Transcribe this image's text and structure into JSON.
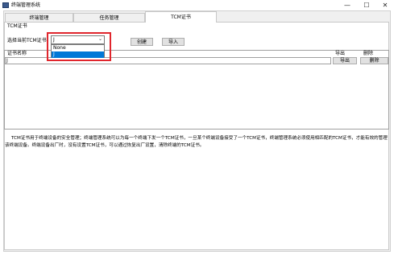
{
  "window": {
    "title": "终端管理系统",
    "minimize_glyph": "—",
    "maximize_glyph": "☐",
    "close_glyph": "✕"
  },
  "tabs": [
    {
      "label": "终端管理"
    },
    {
      "label": "任务管理"
    },
    {
      "label": "TCM证书",
      "active": true
    }
  ],
  "panel": {
    "title": "TCM证书",
    "select_label": "选择当前TCM证书：",
    "select_value": "J",
    "dropdown_options": [
      "None",
      "J"
    ],
    "dropdown_selected_index": 1,
    "create_button": "创建",
    "import_button": "导入"
  },
  "table": {
    "columns": [
      "证书名称",
      "导出",
      "删除"
    ],
    "rows": [
      {
        "name": "J",
        "export_label": "导出",
        "delete_label": "删除"
      }
    ]
  },
  "description": "TCM证书用于终端设备的安全管理；终端管理系统可以为每一个终端下发一个TCM证书，一旦某个终端设备接受了一个TCM证书，终端管理系统必须使用相匹配的TCM证书，才能有效的管理该终端设备。终端设备出厂时，没有设置TCM证书，可以通过恢复出厂设置，清除终端的TCM证书。",
  "colors": {
    "highlight": "#e0262d",
    "selection": "#0078d7"
  }
}
